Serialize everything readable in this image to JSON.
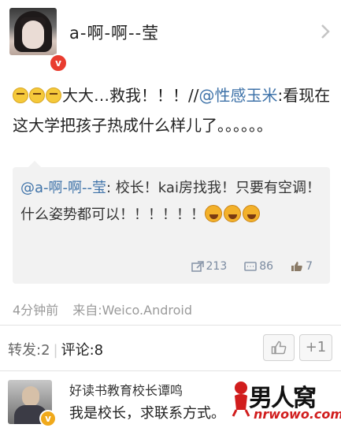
{
  "header": {
    "username": "a-啊-啊--莹",
    "avatar": "user-avatar",
    "badge_icon": "vip-badge-icon",
    "chevron_icon": "chevron-right-icon"
  },
  "post": {
    "text_part1": "大大…救我！！！//",
    "mention": "@性感玉米",
    "text_part2": ":",
    "text_line2": "看现在这大学把孩子热成什么样儿了。。。。。。",
    "emoji_icon": "crying-emoji-icon"
  },
  "repost": {
    "mention": "@a-啊-啊--莹",
    "text": ": 校长！kai房找我！只要有空调！什么姿势都可以！！！！！！",
    "emoji_icon": "drooling-emoji-icon",
    "reposts": "213",
    "comments": "86",
    "likes": "7"
  },
  "meta": {
    "time": "4分钟前",
    "source": "来自:Weico.Android"
  },
  "tabs": {
    "repost_label": "转发:2",
    "comment_label": "评论:8",
    "plus_one": "+1"
  },
  "comment": {
    "name": "好读书教育校长谭鸣",
    "text": "我是校长，求联系方式。"
  },
  "watermark": {
    "main": "男人窝",
    "sub": "nrwowo.com"
  },
  "colors": {
    "mention": "#3f73a9",
    "stats": "#7a8aa0",
    "watermark_red": "#d11d1d"
  }
}
